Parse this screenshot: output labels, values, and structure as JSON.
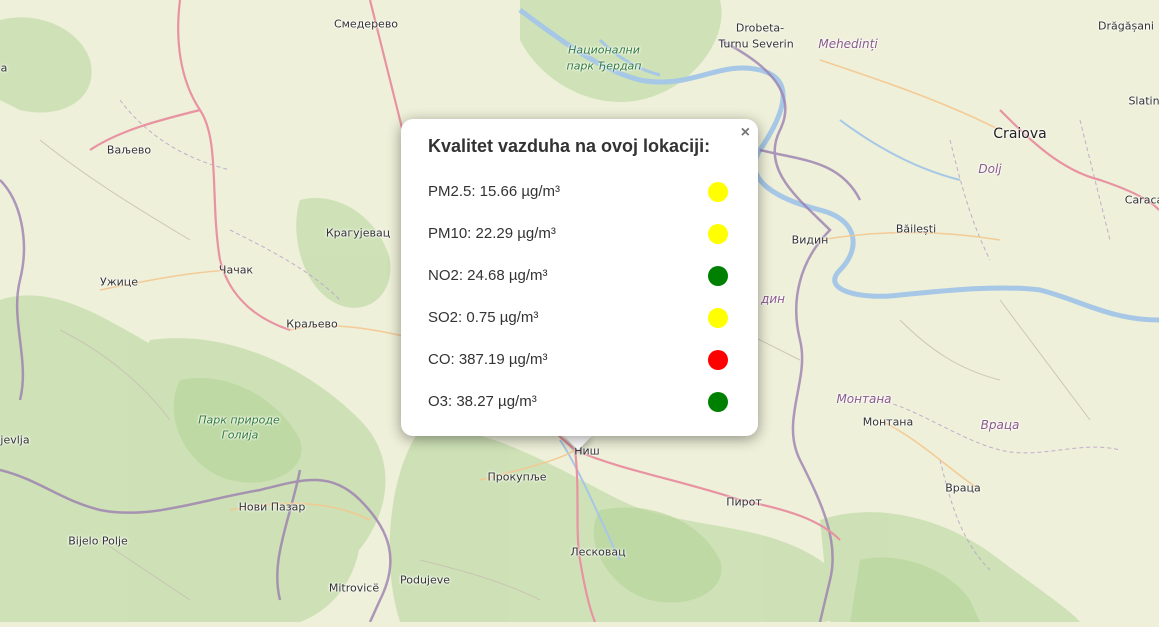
{
  "colors": {
    "good": "#008000",
    "moderate": "#ffff00",
    "bad": "#ff0000"
  },
  "map_labels": [
    {
      "name": "smederevo",
      "text": "Смедерево",
      "kind": "city"
    },
    {
      "name": "drobeta",
      "text": "Drobeta-",
      "kind": "city"
    },
    {
      "name": "turnu-severin",
      "text": "Turnu Severin",
      "kind": "city"
    },
    {
      "name": "mehedinti",
      "text": "Mehedinți",
      "kind": "region"
    },
    {
      "name": "dragasani",
      "text": "Drăgășani",
      "kind": "city"
    },
    {
      "name": "nacionalni",
      "text": "Национални",
      "kind": "park"
    },
    {
      "name": "park-djerdap",
      "text": "парк Ђердап",
      "kind": "park"
    },
    {
      "name": "valjevo",
      "text": "Ваљево",
      "kind": "city"
    },
    {
      "name": "craiova",
      "text": "Craiova",
      "kind": "big"
    },
    {
      "name": "dolj",
      "text": "Dolj",
      "kind": "region"
    },
    {
      "name": "slatina",
      "text": "Slatin",
      "kind": "city"
    },
    {
      "name": "caracal",
      "text": "Caraca",
      "kind": "city"
    },
    {
      "name": "kragujevac",
      "text": "Крагујевац",
      "kind": "city"
    },
    {
      "name": "vidin",
      "text": "Видин",
      "kind": "city"
    },
    {
      "name": "bailesti",
      "text": "Băilești",
      "kind": "city"
    },
    {
      "name": "cacak",
      "text": "Чачак",
      "kind": "city"
    },
    {
      "name": "uzice",
      "text": "Ужице",
      "kind": "city"
    },
    {
      "name": "vidin-region",
      "text": "дин",
      "kind": "region"
    },
    {
      "name": "kraljevo",
      "text": "Краљево",
      "kind": "city"
    },
    {
      "name": "montana-region",
      "text": "Монтана",
      "kind": "region"
    },
    {
      "name": "park-prirode",
      "text": "Парк природе",
      "kind": "park"
    },
    {
      "name": "golija",
      "text": "Голија",
      "kind": "park"
    },
    {
      "name": "montana",
      "text": "Монтана",
      "kind": "city"
    },
    {
      "name": "vraca-region",
      "text": "Враца",
      "kind": "region"
    },
    {
      "name": "sjenica",
      "text": "jevlja",
      "kind": "city"
    },
    {
      "name": "nis",
      "text": "Ниш",
      "kind": "city"
    },
    {
      "name": "prokuplje",
      "text": "Прокупље",
      "kind": "city"
    },
    {
      "name": "vraca",
      "text": "Враца",
      "kind": "city"
    },
    {
      "name": "novi-pazar",
      "text": "Нови Пазар",
      "kind": "city"
    },
    {
      "name": "pirot",
      "text": "Пирот",
      "kind": "city"
    },
    {
      "name": "bijelo-polje",
      "text": "Bijelo Polje",
      "kind": "city"
    },
    {
      "name": "leskovac",
      "text": "Лесковац",
      "kind": "city"
    },
    {
      "name": "mitrovice",
      "text": "Mitrovicë",
      "kind": "city"
    },
    {
      "name": "podujeve",
      "text": "Podujeve",
      "kind": "city"
    },
    {
      "name": "slatina-top",
      "text": "a",
      "kind": "city"
    }
  ],
  "popup": {
    "title": "Kvalitet vazduha na ovoj lokaciji:",
    "close": "×",
    "rows": [
      {
        "label": "PM2.5: 15.66 µg/m³",
        "status": "moderate"
      },
      {
        "label": "PM10: 22.29 µg/m³",
        "status": "moderate"
      },
      {
        "label": "NO2: 24.68 µg/m³",
        "status": "good"
      },
      {
        "label": "SO2: 0.75 µg/m³",
        "status": "moderate"
      },
      {
        "label": "CO: 387.19 µg/m³",
        "status": "bad"
      },
      {
        "label": "O3: 38.27 µg/m³",
        "status": "good"
      }
    ]
  }
}
